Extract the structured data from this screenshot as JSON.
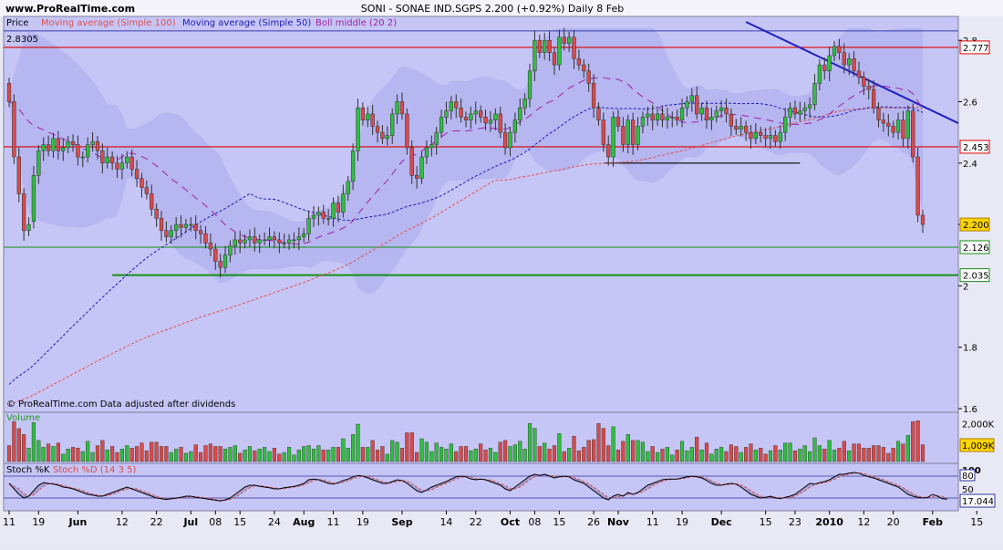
{
  "site": "www.ProRealTime.com",
  "title": {
    "symbol": "SONI - SONAE IND.SGPS",
    "quote": "2.200 (+0.92%)",
    "timeframe": "Daily",
    "date": "8 Feb"
  },
  "legend": {
    "price": "Price",
    "ma100": "Moving average (Simple 100)",
    "ma50": "Moving average (Simple 50)",
    "boll": "Boll middle (20 2)"
  },
  "colors": {
    "ma100": "#e05050",
    "ma50": "#1c1cb4",
    "boll": "#a020a0",
    "bull": "#2fbe3e",
    "bear": "#d84a4a",
    "band": "#b4b4f0",
    "panel": "#c6c6f6",
    "resistance": "#e00000",
    "support": "#129012",
    "trend": "#2020c0"
  },
  "max_label": "2.8305",
  "footer": "© ProRealTime.com  Data adjusted after dividends",
  "price_axis": {
    "ticks": [
      "2.8",
      "2.6",
      "2.4",
      "2.2",
      "2",
      "1.8",
      "1.6"
    ],
    "ylim": [
      1.6,
      2.86
    ]
  },
  "price_tags": [
    {
      "text": "2.777",
      "value": 2.777,
      "fill": "#ffffff",
      "border": "#e00000"
    },
    {
      "text": "2.453",
      "value": 2.453,
      "fill": "#ffffff",
      "border": "#e00000"
    },
    {
      "text": "2.200",
      "value": 2.2,
      "fill": "#ffd400",
      "border": "#b08000"
    },
    {
      "text": "2.126",
      "value": 2.126,
      "fill": "#ffffff",
      "border": "#129012"
    },
    {
      "text": "2.035",
      "value": 2.035,
      "fill": "#ffffff",
      "border": "#129012"
    }
  ],
  "volume": {
    "title": "Volume",
    "ticks": [
      "2,000K"
    ],
    "last_label": "1,009K",
    "ylim": [
      0,
      2400
    ]
  },
  "stoch": {
    "title_k": "Stoch %K",
    "title_d": "Stoch %D (14 3 5)",
    "ticks": [
      "100",
      "80",
      "50"
    ],
    "last_label": "17.044",
    "ylim": [
      0,
      100
    ]
  },
  "x_axis": {
    "labels": [
      {
        "text": "11",
        "i": 0
      },
      {
        "text": "19",
        "i": 6
      },
      {
        "text": "Jun",
        "i": 14
      },
      {
        "text": "12",
        "i": 23
      },
      {
        "text": "22",
        "i": 30
      },
      {
        "text": "Jul",
        "i": 37
      },
      {
        "text": "08",
        "i": 42
      },
      {
        "text": "15",
        "i": 47
      },
      {
        "text": "24",
        "i": 54
      },
      {
        "text": "Aug",
        "i": 60
      },
      {
        "text": "11",
        "i": 66
      },
      {
        "text": "19",
        "i": 72
      },
      {
        "text": "Sep",
        "i": 80
      },
      {
        "text": "14",
        "i": 89
      },
      {
        "text": "22",
        "i": 95
      },
      {
        "text": "Oct",
        "i": 102
      },
      {
        "text": "08",
        "i": 107
      },
      {
        "text": "15",
        "i": 112
      },
      {
        "text": "26",
        "i": 119
      },
      {
        "text": "Nov",
        "i": 124
      },
      {
        "text": "11",
        "i": 131
      },
      {
        "text": "19",
        "i": 137
      },
      {
        "text": "Dec",
        "i": 145
      },
      {
        "text": "15",
        "i": 154
      },
      {
        "text": "23",
        "i": 160
      },
      {
        "text": "2010",
        "i": 167
      },
      {
        "text": "12",
        "i": 174
      },
      {
        "text": "20",
        "i": 180
      },
      {
        "text": "Feb",
        "i": 188
      },
      {
        "text": "15",
        "i": 197
      }
    ]
  },
  "chart_data": {
    "type": "candlestick",
    "close": [
      2.6,
      2.42,
      2.3,
      2.18,
      2.2,
      2.36,
      2.44,
      2.46,
      2.44,
      2.48,
      2.44,
      2.45,
      2.47,
      2.46,
      2.42,
      2.42,
      2.46,
      2.47,
      2.44,
      2.4,
      2.42,
      2.4,
      2.38,
      2.4,
      2.42,
      2.38,
      2.35,
      2.32,
      2.3,
      2.25,
      2.22,
      2.18,
      2.16,
      2.18,
      2.2,
      2.19,
      2.2,
      2.2,
      2.18,
      2.17,
      2.14,
      2.12,
      2.08,
      2.06,
      2.1,
      2.13,
      2.15,
      2.14,
      2.15,
      2.16,
      2.14,
      2.15,
      2.15,
      2.16,
      2.15,
      2.14,
      2.14,
      2.15,
      2.15,
      2.16,
      2.17,
      2.22,
      2.23,
      2.24,
      2.22,
      2.22,
      2.27,
      2.24,
      2.3,
      2.34,
      2.44,
      2.58,
      2.54,
      2.56,
      2.52,
      2.5,
      2.48,
      2.49,
      2.56,
      2.6,
      2.56,
      2.45,
      2.36,
      2.35,
      2.42,
      2.45,
      2.46,
      2.5,
      2.55,
      2.57,
      2.6,
      2.58,
      2.55,
      2.54,
      2.56,
      2.57,
      2.55,
      2.53,
      2.54,
      2.56,
      2.5,
      2.45,
      2.5,
      2.54,
      2.58,
      2.61,
      2.7,
      2.8,
      2.76,
      2.8,
      2.76,
      2.72,
      2.81,
      2.79,
      2.81,
      2.74,
      2.72,
      2.7,
      2.66,
      2.58,
      2.54,
      2.46,
      2.42,
      2.55,
      2.52,
      2.46,
      2.54,
      2.46,
      2.52,
      2.55,
      2.56,
      2.54,
      2.56,
      2.54,
      2.55,
      2.55,
      2.54,
      2.58,
      2.6,
      2.62,
      2.56,
      2.58,
      2.54,
      2.55,
      2.57,
      2.58,
      2.56,
      2.52,
      2.51,
      2.52,
      2.5,
      2.48,
      2.5,
      2.49,
      2.48,
      2.49,
      2.47,
      2.5,
      2.55,
      2.58,
      2.56,
      2.57,
      2.58,
      2.59,
      2.66,
      2.72,
      2.7,
      2.75,
      2.78,
      2.76,
      2.72,
      2.74,
      2.7,
      2.68,
      2.65,
      2.64,
      2.58,
      2.54,
      2.53,
      2.52,
      2.5,
      2.54,
      2.48,
      2.57,
      2.42,
      2.23,
      2.2
    ],
    "open": [
      2.66,
      2.6,
      2.42,
      2.3,
      2.18,
      2.21,
      2.36,
      2.44,
      2.46,
      2.44,
      2.48,
      2.44,
      2.45,
      2.47,
      2.46,
      2.42,
      2.42,
      2.46,
      2.47,
      2.44,
      2.4,
      2.42,
      2.4,
      2.38,
      2.4,
      2.42,
      2.38,
      2.35,
      2.32,
      2.3,
      2.25,
      2.22,
      2.18,
      2.16,
      2.18,
      2.2,
      2.19,
      2.2,
      2.2,
      2.18,
      2.17,
      2.14,
      2.12,
      2.08,
      2.06,
      2.1,
      2.13,
      2.15,
      2.14,
      2.15,
      2.16,
      2.14,
      2.15,
      2.15,
      2.16,
      2.15,
      2.14,
      2.14,
      2.15,
      2.15,
      2.16,
      2.17,
      2.22,
      2.23,
      2.24,
      2.22,
      2.22,
      2.27,
      2.24,
      2.3,
      2.34,
      2.44,
      2.58,
      2.54,
      2.56,
      2.52,
      2.5,
      2.48,
      2.49,
      2.56,
      2.6,
      2.56,
      2.45,
      2.36,
      2.35,
      2.42,
      2.45,
      2.46,
      2.5,
      2.55,
      2.57,
      2.6,
      2.58,
      2.55,
      2.54,
      2.56,
      2.57,
      2.55,
      2.53,
      2.54,
      2.56,
      2.5,
      2.45,
      2.5,
      2.54,
      2.58,
      2.61,
      2.7,
      2.8,
      2.76,
      2.8,
      2.76,
      2.72,
      2.81,
      2.79,
      2.81,
      2.74,
      2.72,
      2.7,
      2.66,
      2.58,
      2.54,
      2.46,
      2.42,
      2.55,
      2.52,
      2.46,
      2.54,
      2.46,
      2.52,
      2.55,
      2.56,
      2.54,
      2.56,
      2.54,
      2.55,
      2.55,
      2.54,
      2.58,
      2.6,
      2.62,
      2.56,
      2.58,
      2.54,
      2.55,
      2.57,
      2.58,
      2.56,
      2.52,
      2.51,
      2.52,
      2.5,
      2.48,
      2.5,
      2.49,
      2.48,
      2.49,
      2.47,
      2.5,
      2.55,
      2.58,
      2.56,
      2.57,
      2.58,
      2.59,
      2.66,
      2.72,
      2.7,
      2.75,
      2.78,
      2.76,
      2.72,
      2.74,
      2.7,
      2.68,
      2.65,
      2.64,
      2.58,
      2.54,
      2.53,
      2.52,
      2.5,
      2.54,
      2.48,
      2.57,
      2.42,
      2.23
    ],
    "ma50_start": 1.66,
    "ma100_start": 1.6,
    "stoch_k": [
      60,
      45,
      30,
      20,
      25,
      40,
      55,
      62,
      60,
      58,
      55,
      50,
      48,
      45,
      40,
      35,
      30,
      28,
      25,
      25,
      30,
      35,
      40,
      45,
      50,
      45,
      40,
      35,
      30,
      25,
      20,
      18,
      16,
      18,
      20,
      22,
      25,
      25,
      22,
      20,
      18,
      16,
      14,
      12,
      15,
      20,
      30,
      40,
      50,
      55,
      55,
      52,
      50,
      48,
      45,
      45,
      48,
      50,
      52,
      55,
      60,
      70,
      72,
      70,
      65,
      60,
      58,
      62,
      68,
      72,
      78,
      82,
      80,
      75,
      70,
      65,
      60,
      60,
      65,
      70,
      68,
      60,
      50,
      40,
      35,
      42,
      50,
      55,
      60,
      65,
      72,
      78,
      80,
      78,
      72,
      70,
      72,
      70,
      65,
      60,
      55,
      45,
      40,
      50,
      60,
      70,
      80,
      85,
      82,
      85,
      80,
      75,
      78,
      80,
      78,
      70,
      65,
      60,
      50,
      40,
      30,
      20,
      15,
      25,
      30,
      25,
      35,
      30,
      35,
      45,
      55,
      60,
      65,
      70,
      72,
      72,
      72,
      75,
      78,
      80,
      78,
      75,
      68,
      60,
      55,
      55,
      58,
      60,
      58,
      50,
      40,
      30,
      25,
      20,
      22,
      25,
      20,
      18,
      22,
      25,
      30,
      40,
      50,
      60,
      58,
      62,
      65,
      70,
      78,
      85,
      85,
      88,
      90,
      88,
      82,
      78,
      75,
      70,
      65,
      60,
      55,
      50,
      40,
      30,
      25,
      22,
      20,
      22,
      30,
      25,
      18,
      17
    ]
  }
}
